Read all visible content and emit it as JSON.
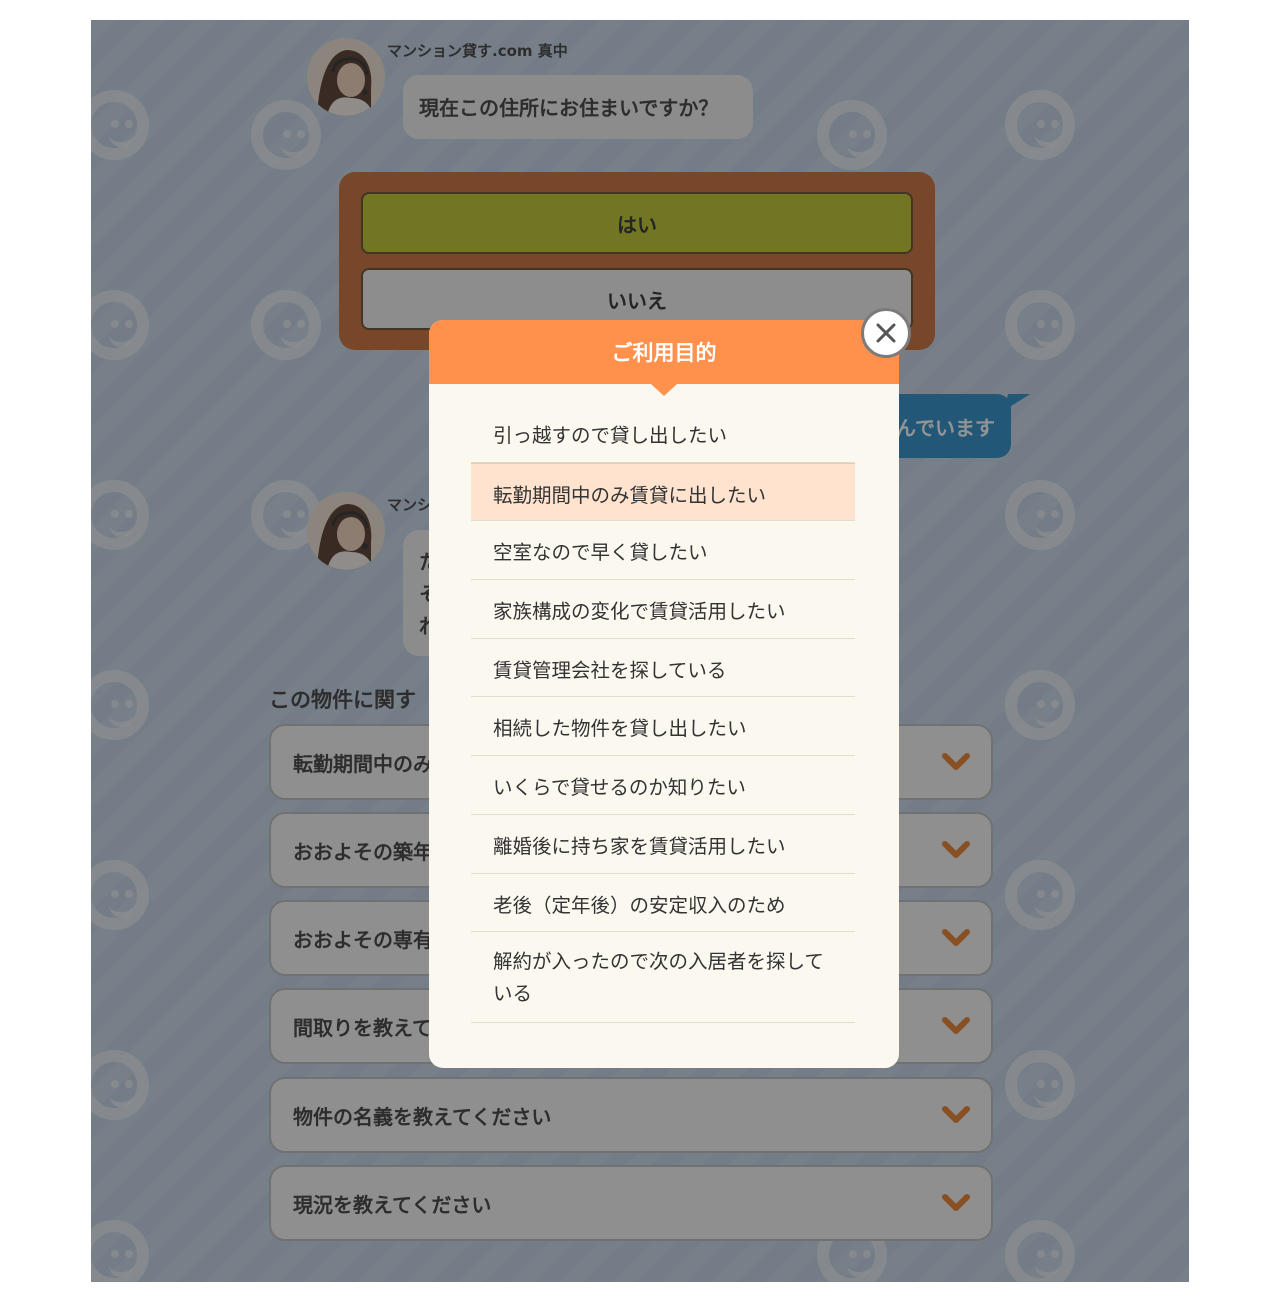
{
  "chat": {
    "agent_name": "マンション貸す.com 真中",
    "agent_name_partial": "マンシ",
    "question": "現在この住所にお住まいですか？",
    "choices": {
      "yes": "はい",
      "no": "いいえ"
    },
    "user_reply_visible": "んでいます",
    "partial_bubble_lines": [
      "た",
      "そ",
      "れ"
    ]
  },
  "property_section": {
    "title_visible": "この物件に関す",
    "accordion": [
      {
        "label": "転勤期間中のみ"
      },
      {
        "label": "おおよその築年"
      },
      {
        "label": "おおよその専有"
      },
      {
        "label": "間取りを教えて"
      },
      {
        "label": "物件の名義を教えてください"
      },
      {
        "label": "現況を教えてください"
      }
    ]
  },
  "modal": {
    "title": "ご利用目的",
    "options": [
      "引っ越すので貸し出したい",
      "転勤期間中のみ賃貸に出したい",
      "空室なので早く貸したい",
      "家族構成の変化で賃貸活用したい",
      "賃貸管理会社を探している",
      "相続した物件を貸し出したい",
      "いくらで貸せるのか知りたい",
      "離婚後に持ち家を賃貸活用したい",
      "老後（定年後）の安定収入のため",
      "解約が入ったので次の入居者を探している"
    ],
    "selected_index": 1
  },
  "icons": {
    "close": "close-icon",
    "chevron": "chevron-down-icon",
    "avatar": "agent-avatar"
  },
  "colors": {
    "accent_orange": "#ff914d",
    "choice_frame": "#c9662b",
    "yes_button": "#bcc41c",
    "reply_bubble": "#1e86c8",
    "highlight_option": "#ffe3cf",
    "chevron": "#e8781e"
  }
}
